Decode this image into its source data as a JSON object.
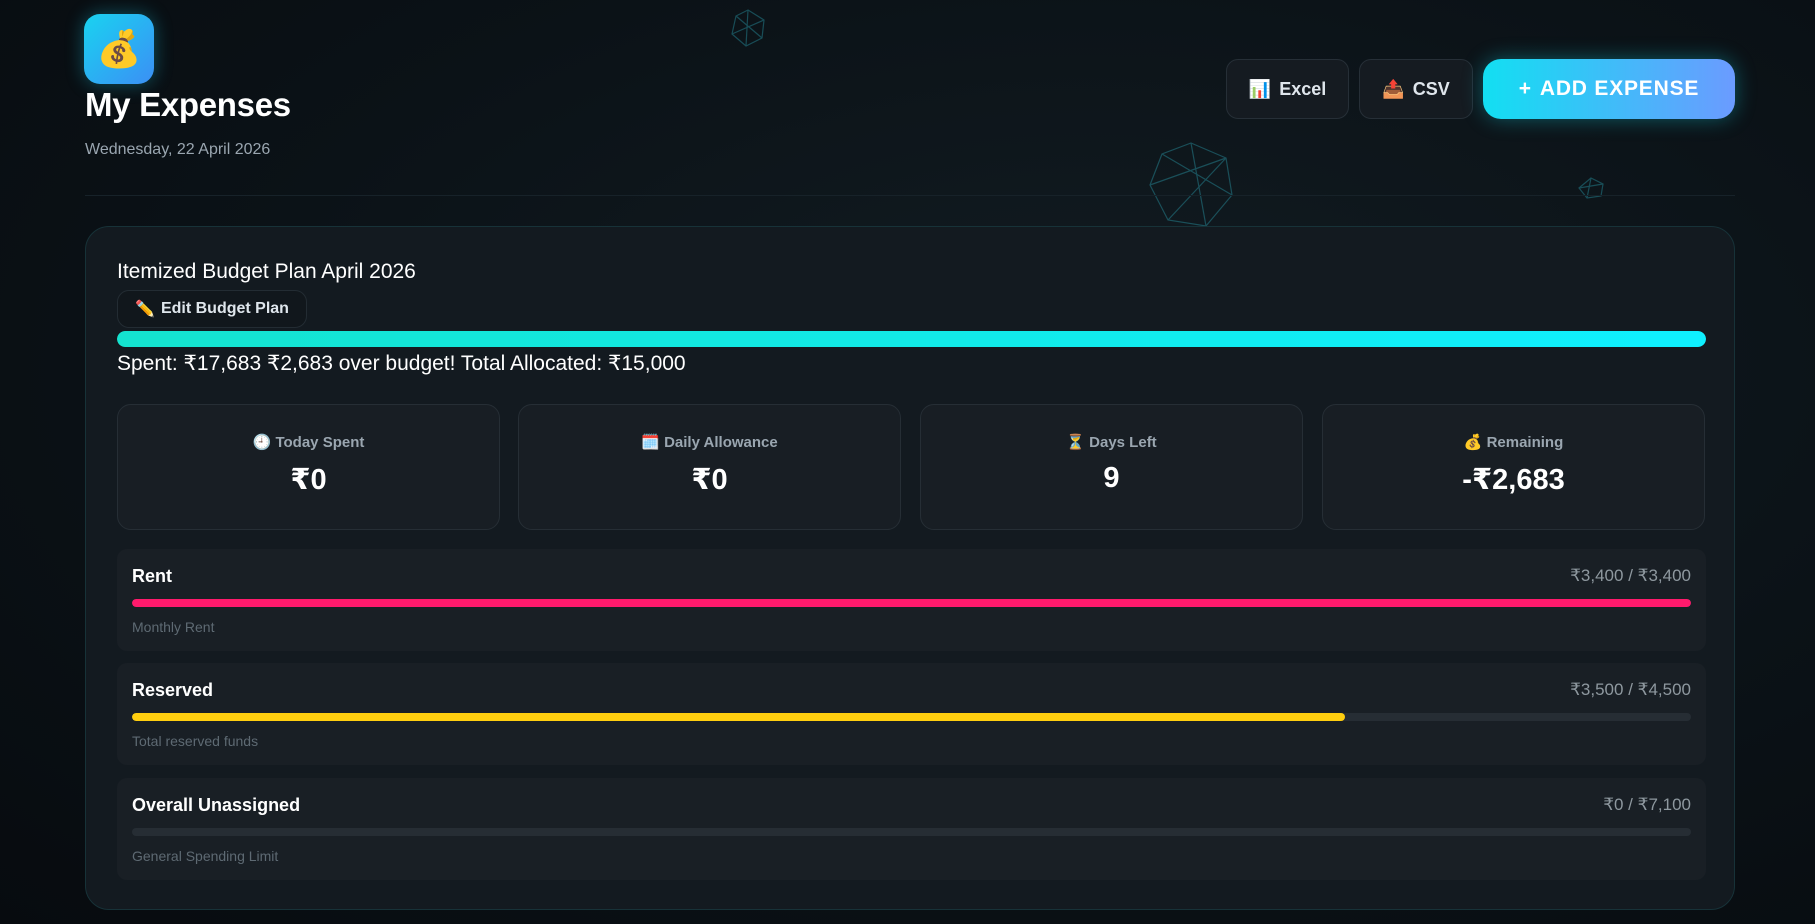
{
  "header": {
    "app_icon": "money-bag-icon",
    "title": "My Expenses",
    "date": "Wednesday, 22 April 2026"
  },
  "actions": {
    "excel": {
      "icon": "📊",
      "label": "Excel"
    },
    "csv": {
      "icon": "📤",
      "label": "CSV"
    },
    "add": {
      "icon": "+",
      "label": "ADD EXPENSE"
    }
  },
  "budget": {
    "title": "Itemized Budget Plan April 2026",
    "edit": {
      "icon": "✏️",
      "label": "Edit Budget Plan"
    },
    "progress_fraction": 1.0,
    "summary": "Spent: ₹17,683 ₹2,683 over budget! Total Allocated: ₹15,000"
  },
  "stats": [
    {
      "icon": "🕘",
      "label": "Today Spent",
      "value": "₹0"
    },
    {
      "icon": "🗓️",
      "label": "Daily Allowance",
      "value": "₹0"
    },
    {
      "icon": "⏳",
      "label": "Days Left",
      "value": "9"
    },
    {
      "icon": "💰",
      "label": "Remaining",
      "value": "-₹2,683"
    }
  ],
  "categories": [
    {
      "name": "Rent",
      "amount": "₹3,400 / ₹3,400",
      "description": "Monthly Rent",
      "fraction": 1.0,
      "color": "#ff1a6c"
    },
    {
      "name": "Reserved",
      "amount": "₹3,500 / ₹4,500",
      "description": "Total reserved funds",
      "fraction": 0.778,
      "color": "#ffce0f"
    },
    {
      "name": "Overall Unassigned",
      "amount": "₹0 / ₹7,100",
      "description": "General Spending Limit",
      "fraction": 0.0,
      "color": "#14e3cf"
    }
  ]
}
